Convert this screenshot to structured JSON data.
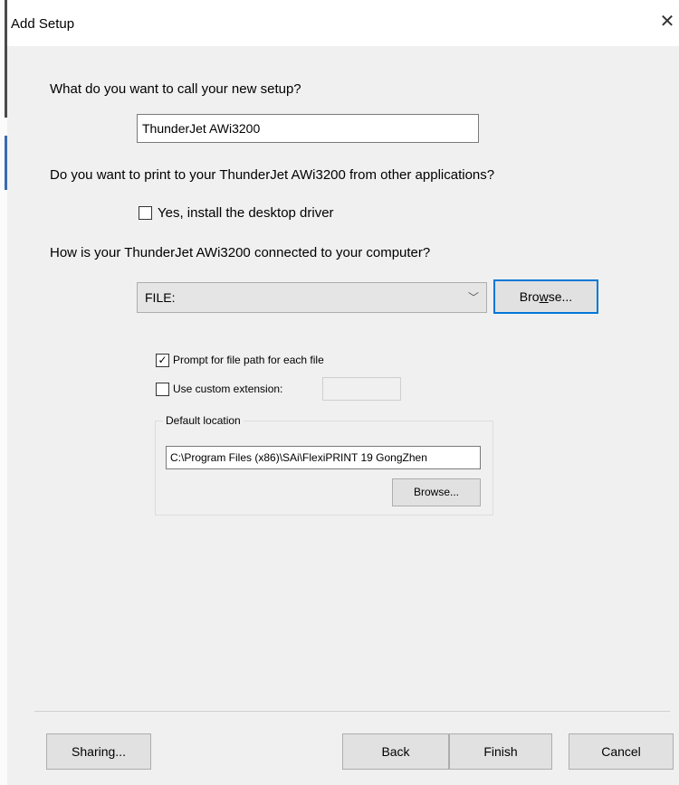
{
  "window": {
    "title": "Add Setup",
    "close_glyph": "✕"
  },
  "setup": {
    "name_question": "What do you want to call your new setup?",
    "name_value": "ThunderJet AWi3200",
    "print_question": "Do you want to print to your ThunderJet AWi3200 from other applications?",
    "desktop_driver_label": "Yes, install the desktop driver",
    "desktop_driver_checked": false,
    "connection_question": "How is your ThunderJet AWi3200 connected to your computer?",
    "connection_value": "FILE:",
    "connection_chevron": "﹀",
    "browse_label_pre": "Bro",
    "browse_label_acc": "w",
    "browse_label_post": "se...",
    "prompt_file_label": "Prompt for file path for each file",
    "prompt_file_checked": true,
    "custom_ext_label": "Use custom extension:",
    "custom_ext_checked": false,
    "custom_ext_value": "",
    "default_location_label": "Default location",
    "default_location_value": "C:\\Program Files (x86)\\SAi\\FlexiPRINT 19 GongZhen",
    "location_browse_label": "Browse..."
  },
  "footer": {
    "sharing_label": "Sharing...",
    "back_label": "Back",
    "finish_label": "Finish",
    "cancel_label": "Cancel"
  },
  "icons": {
    "check_glyph": "✓"
  }
}
